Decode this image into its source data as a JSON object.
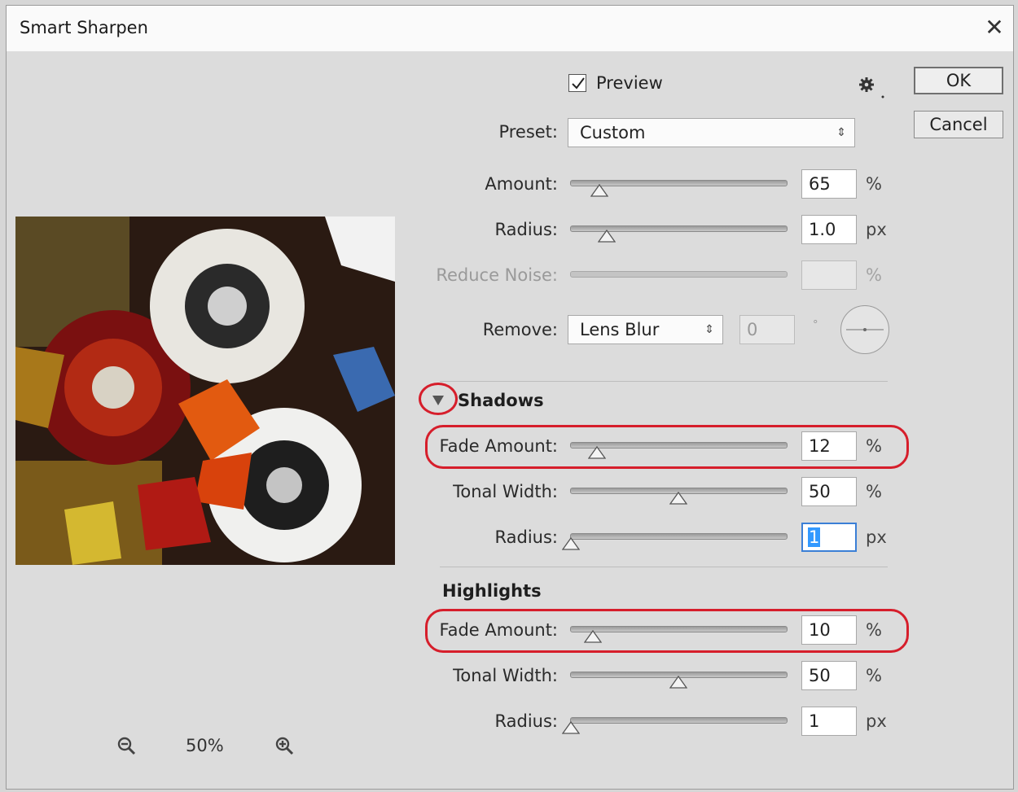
{
  "window": {
    "title": "Smart Sharpen",
    "close_glyph": "✕"
  },
  "preview": {
    "label": "Preview",
    "checked": true
  },
  "settings": {
    "gear_icon": "gear-icon"
  },
  "buttons": {
    "ok": "OK",
    "cancel": "Cancel"
  },
  "preset": {
    "label": "Preset:",
    "value": "Custom",
    "arrows": "⇕"
  },
  "amount": {
    "label": "Amount:",
    "value": "65",
    "unit": "%"
  },
  "radius": {
    "label": "Radius:",
    "value": "1.0",
    "unit": "px"
  },
  "reduce_noise": {
    "label": "Reduce Noise:",
    "value": "",
    "unit": "%"
  },
  "remove": {
    "label": "Remove:",
    "value": "Lens Blur",
    "arrows": "⇕",
    "angle_value": "0",
    "angle_unit": "°"
  },
  "shadows": {
    "title": "Shadows",
    "expanded": true,
    "fade_amount": {
      "label": "Fade Amount:",
      "value": "12",
      "unit": "%"
    },
    "tonal_width": {
      "label": "Tonal Width:",
      "value": "50",
      "unit": "%"
    },
    "radius": {
      "label": "Radius:",
      "value": "1",
      "unit": "px"
    }
  },
  "highlights": {
    "title": "Highlights",
    "fade_amount": {
      "label": "Fade Amount:",
      "value": "10",
      "unit": "%"
    },
    "tonal_width": {
      "label": "Tonal Width:",
      "value": "50",
      "unit": "%"
    },
    "radius": {
      "label": "Radius:",
      "value": "1",
      "unit": "px"
    }
  },
  "zoom": {
    "level": "50%"
  },
  "colors": {
    "highlight_ring": "#d61e2b",
    "selection": "#3399ff",
    "focus": "#3b7fd6"
  }
}
